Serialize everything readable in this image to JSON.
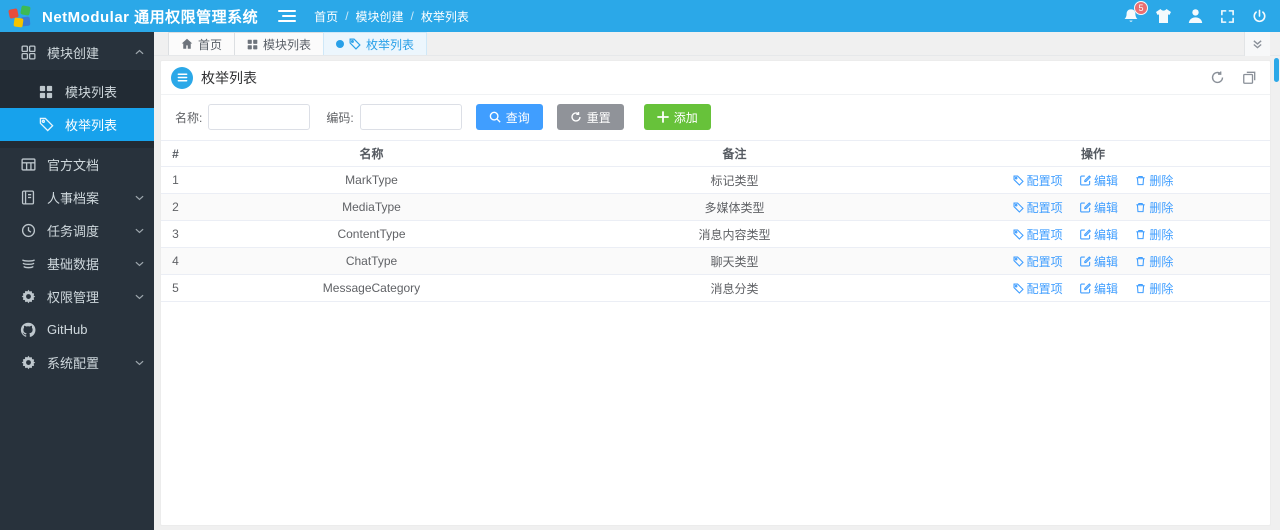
{
  "colors": {
    "accent": "#2ba8e8",
    "sidebar_bg": "#28323c",
    "active_item": "#17a2ec",
    "primary": "#409eff",
    "info": "#909399",
    "success": "#67c23a",
    "danger_badge": "#f56c6c"
  },
  "topbar": {
    "title": "NetModular 通用权限管理系统",
    "breadcrumb": [
      "首页",
      "模块创建",
      "枚举列表"
    ],
    "breadcrumb_separator": "/",
    "notification_count": "5"
  },
  "sidebar": {
    "items": [
      {
        "label": "模块创建"
      },
      {
        "label": "模块列表"
      },
      {
        "label": "枚举列表"
      },
      {
        "label": "官方文档"
      },
      {
        "label": "人事档案"
      },
      {
        "label": "任务调度"
      },
      {
        "label": "基础数据"
      },
      {
        "label": "权限管理"
      },
      {
        "label": "GitHub"
      },
      {
        "label": "系统配置"
      }
    ]
  },
  "tabs": [
    {
      "label": "首页"
    },
    {
      "label": "模块列表"
    },
    {
      "label": "枚举列表"
    }
  ],
  "card": {
    "title": "枚举列表"
  },
  "toolbar": {
    "name_label": "名称:",
    "name_value": "",
    "code_label": "编码:",
    "code_value": "",
    "search_label": "查询",
    "reset_label": "重置",
    "add_label": "添加"
  },
  "table": {
    "columns": [
      "#",
      "名称",
      "备注",
      "操作"
    ],
    "action_labels": {
      "config": "配置项",
      "edit": "编辑",
      "delete": "删除"
    },
    "rows": [
      {
        "index": "1",
        "name": "MarkType",
        "remark": "标记类型"
      },
      {
        "index": "2",
        "name": "MediaType",
        "remark": "多媒体类型"
      },
      {
        "index": "3",
        "name": "ContentType",
        "remark": "消息内容类型"
      },
      {
        "index": "4",
        "name": "ChatType",
        "remark": "聊天类型"
      },
      {
        "index": "5",
        "name": "MessageCategory",
        "remark": "消息分类"
      }
    ]
  }
}
